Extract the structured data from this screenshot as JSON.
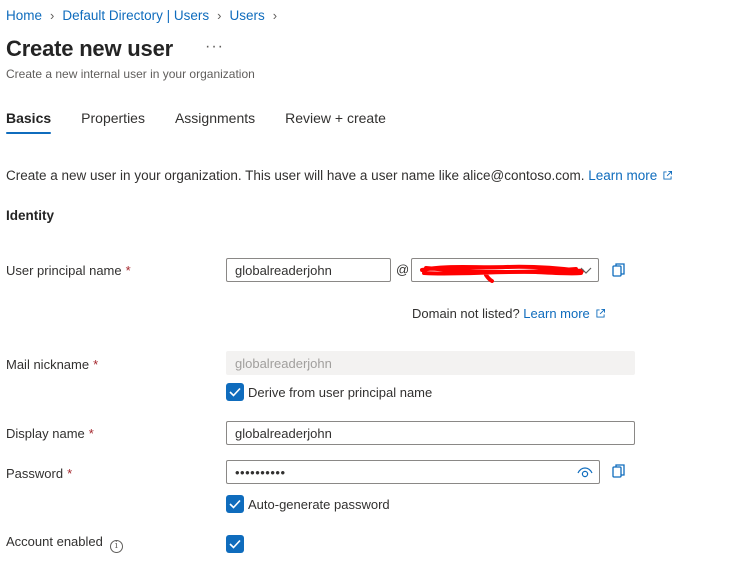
{
  "breadcrumb": {
    "items": [
      "Home",
      "Default Directory | Users",
      "Users"
    ]
  },
  "page": {
    "title": "Create new user",
    "more_label": "···",
    "subtitle": "Create a new internal user in your organization"
  },
  "tabs": [
    {
      "label": "Basics",
      "active": true
    },
    {
      "label": "Properties",
      "active": false
    },
    {
      "label": "Assignments",
      "active": false
    },
    {
      "label": "Review + create",
      "active": false
    }
  ],
  "intro": {
    "text": "Create a new user in your organization. This user will have a user name like alice@contoso.com.",
    "learn_more": "Learn more"
  },
  "section": {
    "identity": "Identity"
  },
  "form": {
    "upn": {
      "label": "User principal name",
      "required_mark": "*",
      "value": "globalreaderjohn",
      "at": "@",
      "domain_redacted": true
    },
    "domain_not_listed": {
      "text": "Domain not listed?",
      "link": "Learn more"
    },
    "mail_nickname": {
      "label": "Mail nickname",
      "required_mark": "*",
      "value": "globalreaderjohn",
      "derive_label": "Derive from user principal name",
      "derive_checked": true
    },
    "display_name": {
      "label": "Display name",
      "required_mark": "*",
      "value": "globalreaderjohn"
    },
    "password": {
      "label": "Password",
      "required_mark": "*",
      "value": "••••••••••",
      "auto_label": "Auto-generate password",
      "auto_checked": true
    },
    "account_enabled": {
      "label": "Account enabled",
      "info_symbol": "i",
      "checked": true
    }
  },
  "colors": {
    "accent": "#0f6cbd",
    "redaction": "#ff0000",
    "required": "#a4262c"
  }
}
